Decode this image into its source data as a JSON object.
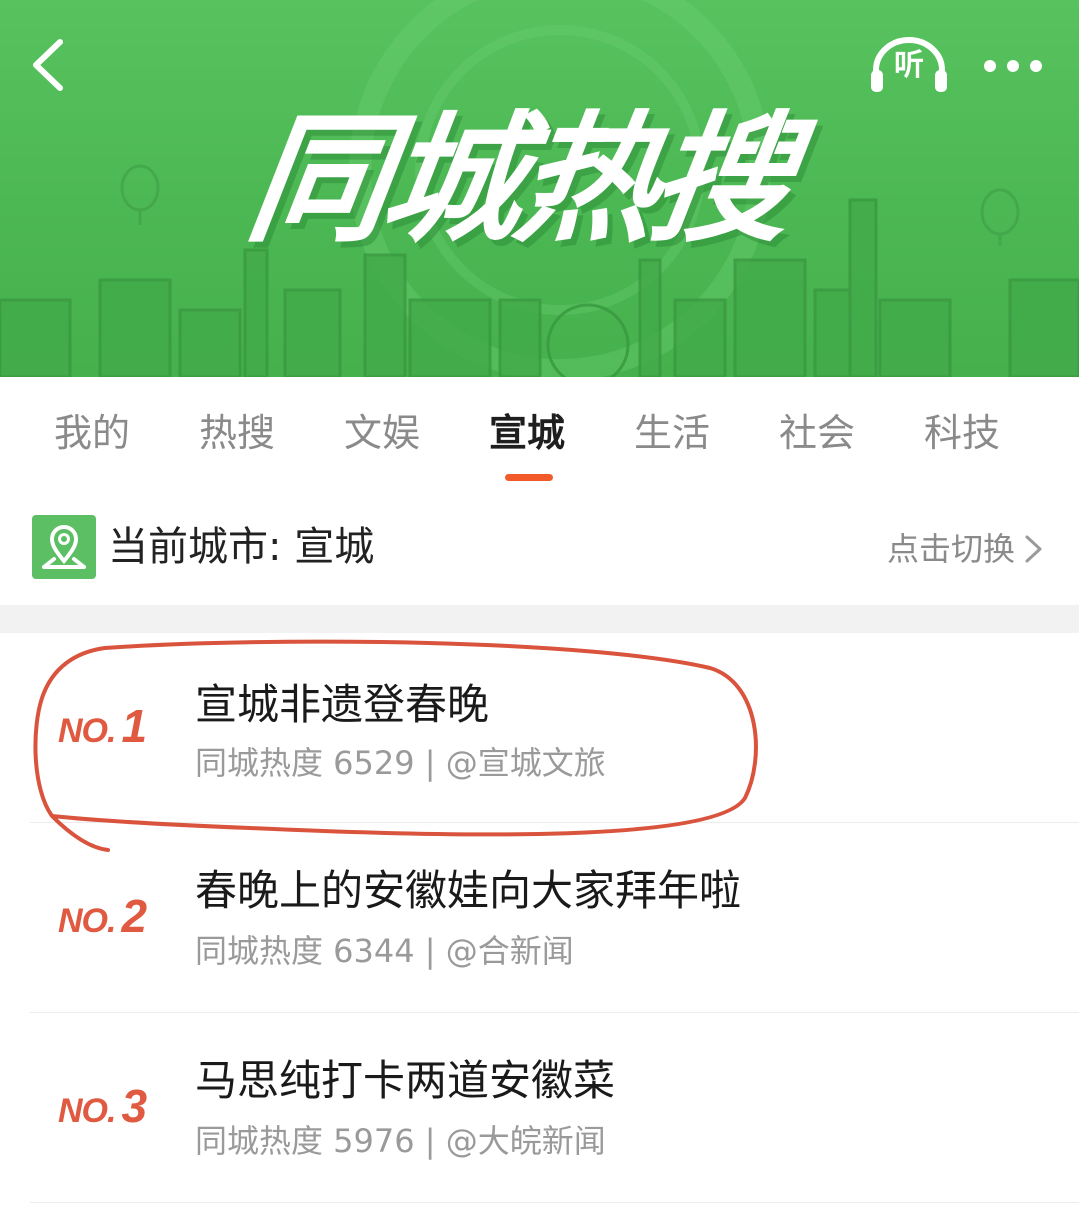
{
  "colors": {
    "banner_green": "#4cb854",
    "accent_orange": "#f25a2a",
    "rank_red": "#e05a42",
    "annotation_red": "#d9533d"
  },
  "header": {
    "back_icon": "chevron-left-icon",
    "listen_label": "听",
    "more_icon": "more-dots-icon",
    "banner_title": "同城热搜"
  },
  "tabs": [
    {
      "label": "我的",
      "active": false
    },
    {
      "label": "热搜",
      "active": false
    },
    {
      "label": "文娱",
      "active": false
    },
    {
      "label": "宣城",
      "active": true
    },
    {
      "label": "生活",
      "active": false
    },
    {
      "label": "社会",
      "active": false
    },
    {
      "label": "科技",
      "active": false
    }
  ],
  "city_bar": {
    "label": "当前城市: 宣城",
    "switch_label": "点击切换",
    "icon": "location-pin-icon"
  },
  "list": [
    {
      "rank_prefix": "NO.",
      "rank": "1",
      "title": "宣城非遗登春晚",
      "meta": "同城热度 6529 | @宣城文旅",
      "circled": true
    },
    {
      "rank_prefix": "NO.",
      "rank": "2",
      "title": "春晚上的安徽娃向大家拜年啦",
      "meta": "同城热度 6344 | @合新闻",
      "circled": false
    },
    {
      "rank_prefix": "NO.",
      "rank": "3",
      "title": "马思纯打卡两道安徽菜",
      "meta": "同城热度 5976 | @大皖新闻",
      "circled": false
    }
  ]
}
